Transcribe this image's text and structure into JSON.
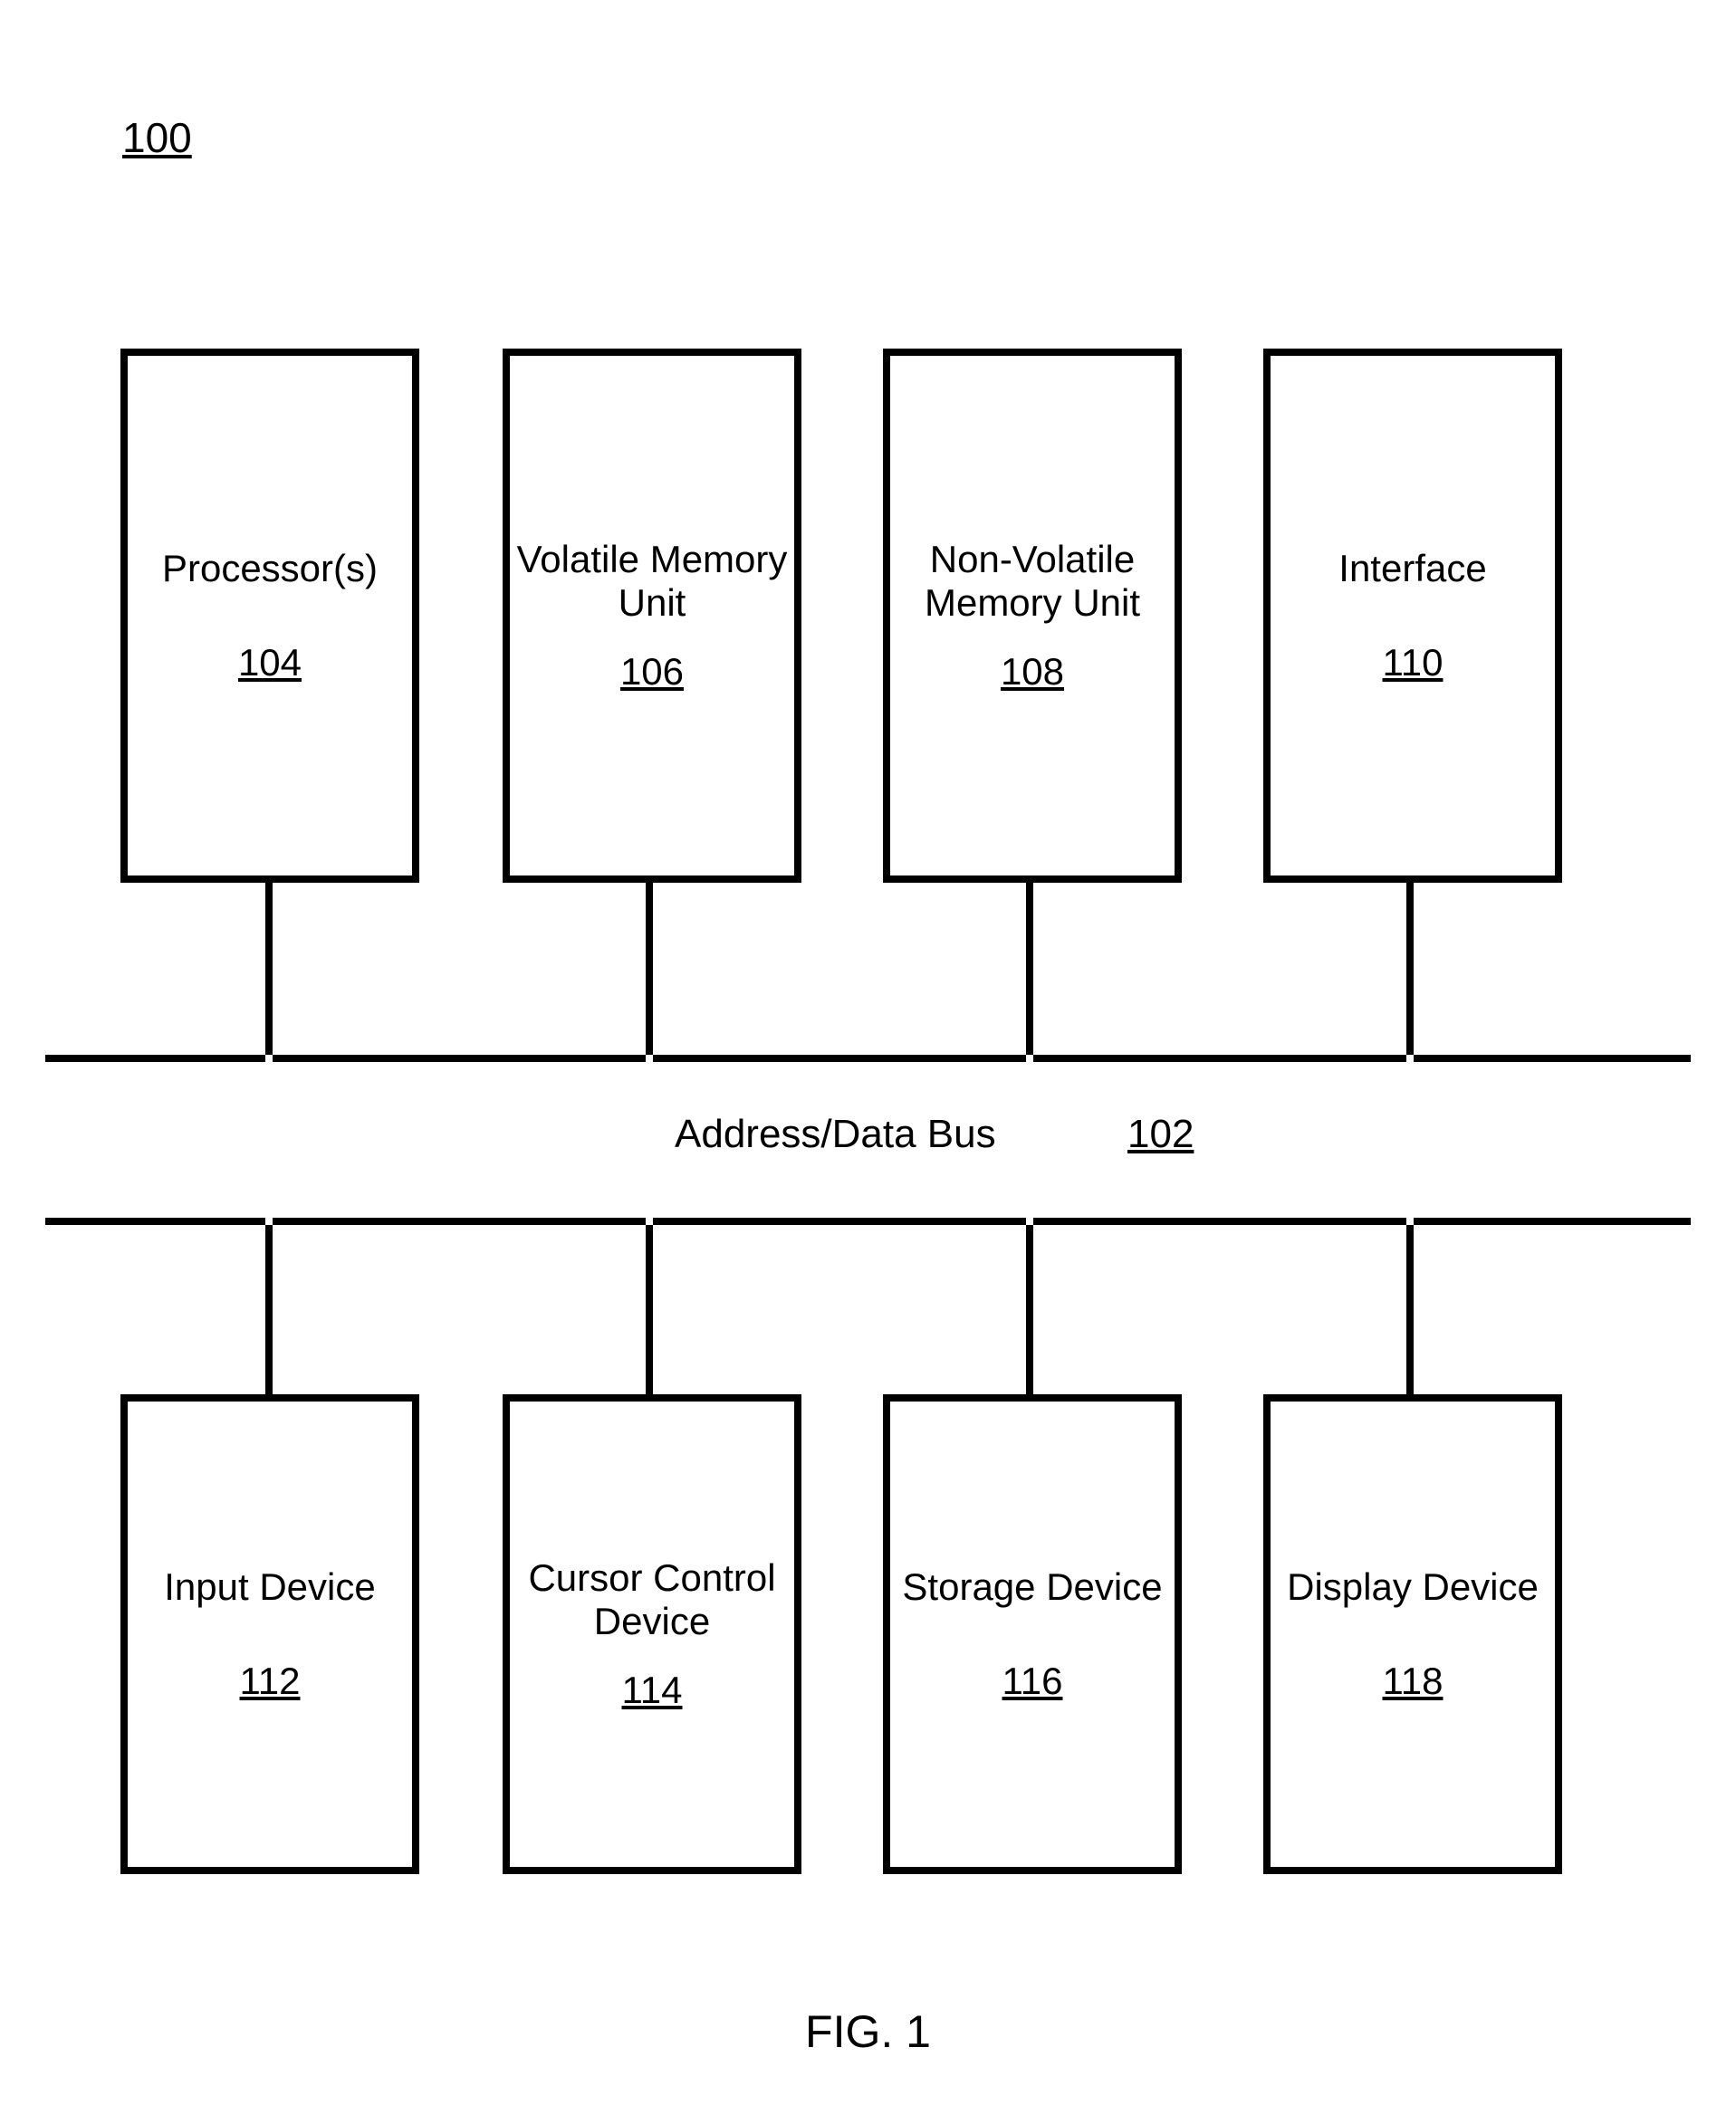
{
  "figure": {
    "system_ref": "100",
    "bus_label": "Address/Data Bus",
    "bus_ref": "102",
    "caption": "FIG. 1"
  },
  "top": [
    {
      "label": "Processor(s)",
      "ref": "104"
    },
    {
      "label": "Volatile Memory Unit",
      "ref": "106"
    },
    {
      "label": "Non-Volatile Memory Unit",
      "ref": "108"
    },
    {
      "label": "Interface",
      "ref": "110"
    }
  ],
  "bottom": [
    {
      "label": "Input Device",
      "ref": "112"
    },
    {
      "label": "Cursor Control Device",
      "ref": "114"
    },
    {
      "label": "Storage Device",
      "ref": "116"
    },
    {
      "label": "Display Device",
      "ref": "118"
    }
  ]
}
